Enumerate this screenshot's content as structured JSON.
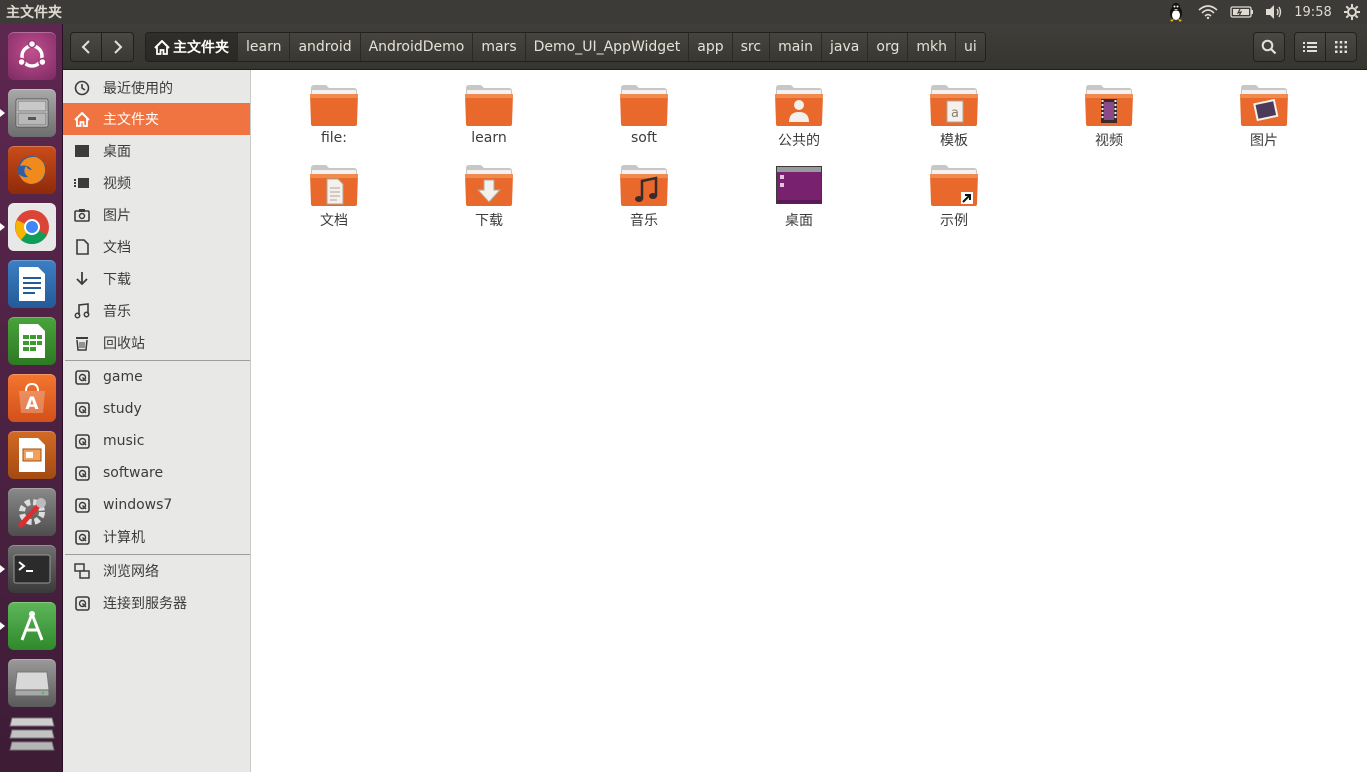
{
  "top_panel": {
    "window_title": "主文件夹",
    "clock": "19:58"
  },
  "launcher": {
    "items": [
      {
        "name": "dash-home-icon"
      },
      {
        "name": "files-icon"
      },
      {
        "name": "firefox-icon"
      },
      {
        "name": "chrome-icon"
      },
      {
        "name": "writer-icon"
      },
      {
        "name": "calc-icon"
      },
      {
        "name": "software-center-icon"
      },
      {
        "name": "impress-icon"
      },
      {
        "name": "system-settings-icon"
      },
      {
        "name": "terminal-icon"
      },
      {
        "name": "android-studio-icon"
      },
      {
        "name": "drive-icon"
      },
      {
        "name": "trash-stack-icon"
      }
    ],
    "colors": {
      "launcher_top": "#5e2750",
      "launcher_bottom": "#3d1c36"
    }
  },
  "headerbar": {
    "pathbar": [
      {
        "label": "主文件夹",
        "current": true
      },
      {
        "label": "learn"
      },
      {
        "label": "android"
      },
      {
        "label": "AndroidDemo"
      },
      {
        "label": "mars"
      },
      {
        "label": "Demo_UI_AppWidget"
      },
      {
        "label": "app"
      },
      {
        "label": "src"
      },
      {
        "label": "main"
      },
      {
        "label": "java"
      },
      {
        "label": "org"
      },
      {
        "label": "mkh"
      },
      {
        "label": "ui"
      }
    ]
  },
  "sidebar": {
    "places": [
      {
        "label": "最近使用的",
        "icon": "recent-icon"
      },
      {
        "label": "主文件夹",
        "icon": "home-icon",
        "selected": true
      },
      {
        "label": "桌面",
        "icon": "desktop-icon"
      },
      {
        "label": "视频",
        "icon": "video-icon"
      },
      {
        "label": "图片",
        "icon": "camera-icon"
      },
      {
        "label": "文档",
        "icon": "document-icon"
      },
      {
        "label": "下载",
        "icon": "download-icon"
      },
      {
        "label": "音乐",
        "icon": "music-icon"
      },
      {
        "label": "回收站",
        "icon": "trash-icon"
      }
    ],
    "devices": [
      {
        "label": "game",
        "icon": "drive-icon"
      },
      {
        "label": "study",
        "icon": "drive-icon"
      },
      {
        "label": "music",
        "icon": "drive-icon"
      },
      {
        "label": "software",
        "icon": "drive-icon"
      },
      {
        "label": "windows7",
        "icon": "drive-icon"
      },
      {
        "label": "计算机",
        "icon": "drive-icon"
      }
    ],
    "network": [
      {
        "label": "浏览网络",
        "icon": "network-icon"
      },
      {
        "label": "连接到服务器",
        "icon": "server-icon"
      }
    ],
    "selected_color": "#ef7442"
  },
  "content": {
    "files": [
      {
        "name": "file:",
        "emblem": "none"
      },
      {
        "name": "learn",
        "emblem": "none"
      },
      {
        "name": "soft",
        "emblem": "none"
      },
      {
        "name": "公共的",
        "emblem": "person"
      },
      {
        "name": "模板",
        "emblem": "template"
      },
      {
        "name": "视频",
        "emblem": "film"
      },
      {
        "name": "图片",
        "emblem": "picture"
      },
      {
        "name": "文档",
        "emblem": "document"
      },
      {
        "name": "下载",
        "emblem": "download"
      },
      {
        "name": "音乐",
        "emblem": "music"
      },
      {
        "name": "桌面",
        "emblem": "desktop"
      },
      {
        "name": "示例",
        "emblem": "link"
      }
    ],
    "folder_color": "#e9692c"
  }
}
